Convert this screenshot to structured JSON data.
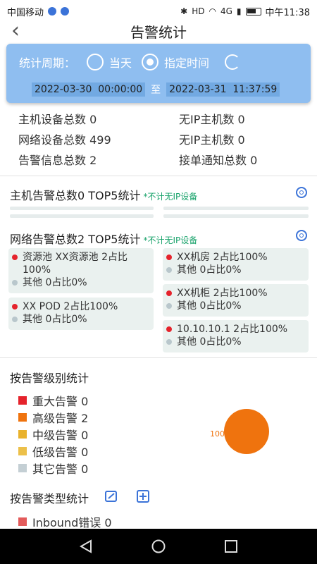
{
  "status_bar": {
    "carrier": "中国移动",
    "net_badges": [
      "HD",
      "4G"
    ],
    "time": "中午11:38"
  },
  "header": {
    "title": "告警统计",
    "back_icon": "chevron-left-icon"
  },
  "period": {
    "label": "统计周期：",
    "options": [
      {
        "label": "当天",
        "selected": false
      },
      {
        "label": "指定时间",
        "selected": true
      }
    ],
    "start": "2022-03-30  00:00:00",
    "separator": "至",
    "end": "2022-03-31  11:37:59"
  },
  "counts": [
    {
      "left": "主机设备总数 0",
      "right": "无IP主机数 0"
    },
    {
      "left": "网络设备总数 499",
      "right": "无IP主机数 0"
    },
    {
      "left": "告警信息总数 2",
      "right": "接单通知总数 0"
    }
  ],
  "host_section": {
    "title": "主机告警总数0 TOP5统计",
    "note": "*不计无IP设备"
  },
  "network_section": {
    "title": "网络告警总数2 TOP5统计",
    "note": "*不计无IP设备",
    "cards": [
      {
        "main": "资源池 XX资源池 2占比100%",
        "other": "其他 0占比0%"
      },
      {
        "main": "XX机房 2占比100%",
        "other": "其他 0占比0%"
      },
      {
        "main": "XX POD 2占比100%",
        "other": "其他 0占比0%"
      },
      {
        "main": "XX机柜 2占比100%",
        "other": "其他 0占比0%"
      },
      {
        "main": "10.10.10.1 2占比100%",
        "other": "其他 0占比0%"
      }
    ]
  },
  "level_section": {
    "title": "按告警级别统计",
    "items": [
      {
        "label": "重大告警 0",
        "color": "#e5232c"
      },
      {
        "label": "高级告警 2",
        "color": "#ef730e"
      },
      {
        "label": "中级告警 0",
        "color": "#e9b22c"
      },
      {
        "label": "低级告警 0",
        "color": "#ecc04a"
      },
      {
        "label": "其它告警 0",
        "color": "#c4cfd4"
      }
    ],
    "pie_label": "100"
  },
  "type_section": {
    "title": "按告警类型统计",
    "items": [
      {
        "label": "Inbound错误 0",
        "color": "#e35b5b"
      }
    ]
  },
  "nav": [
    "back-triangle",
    "home-circle",
    "recents-square"
  ]
}
